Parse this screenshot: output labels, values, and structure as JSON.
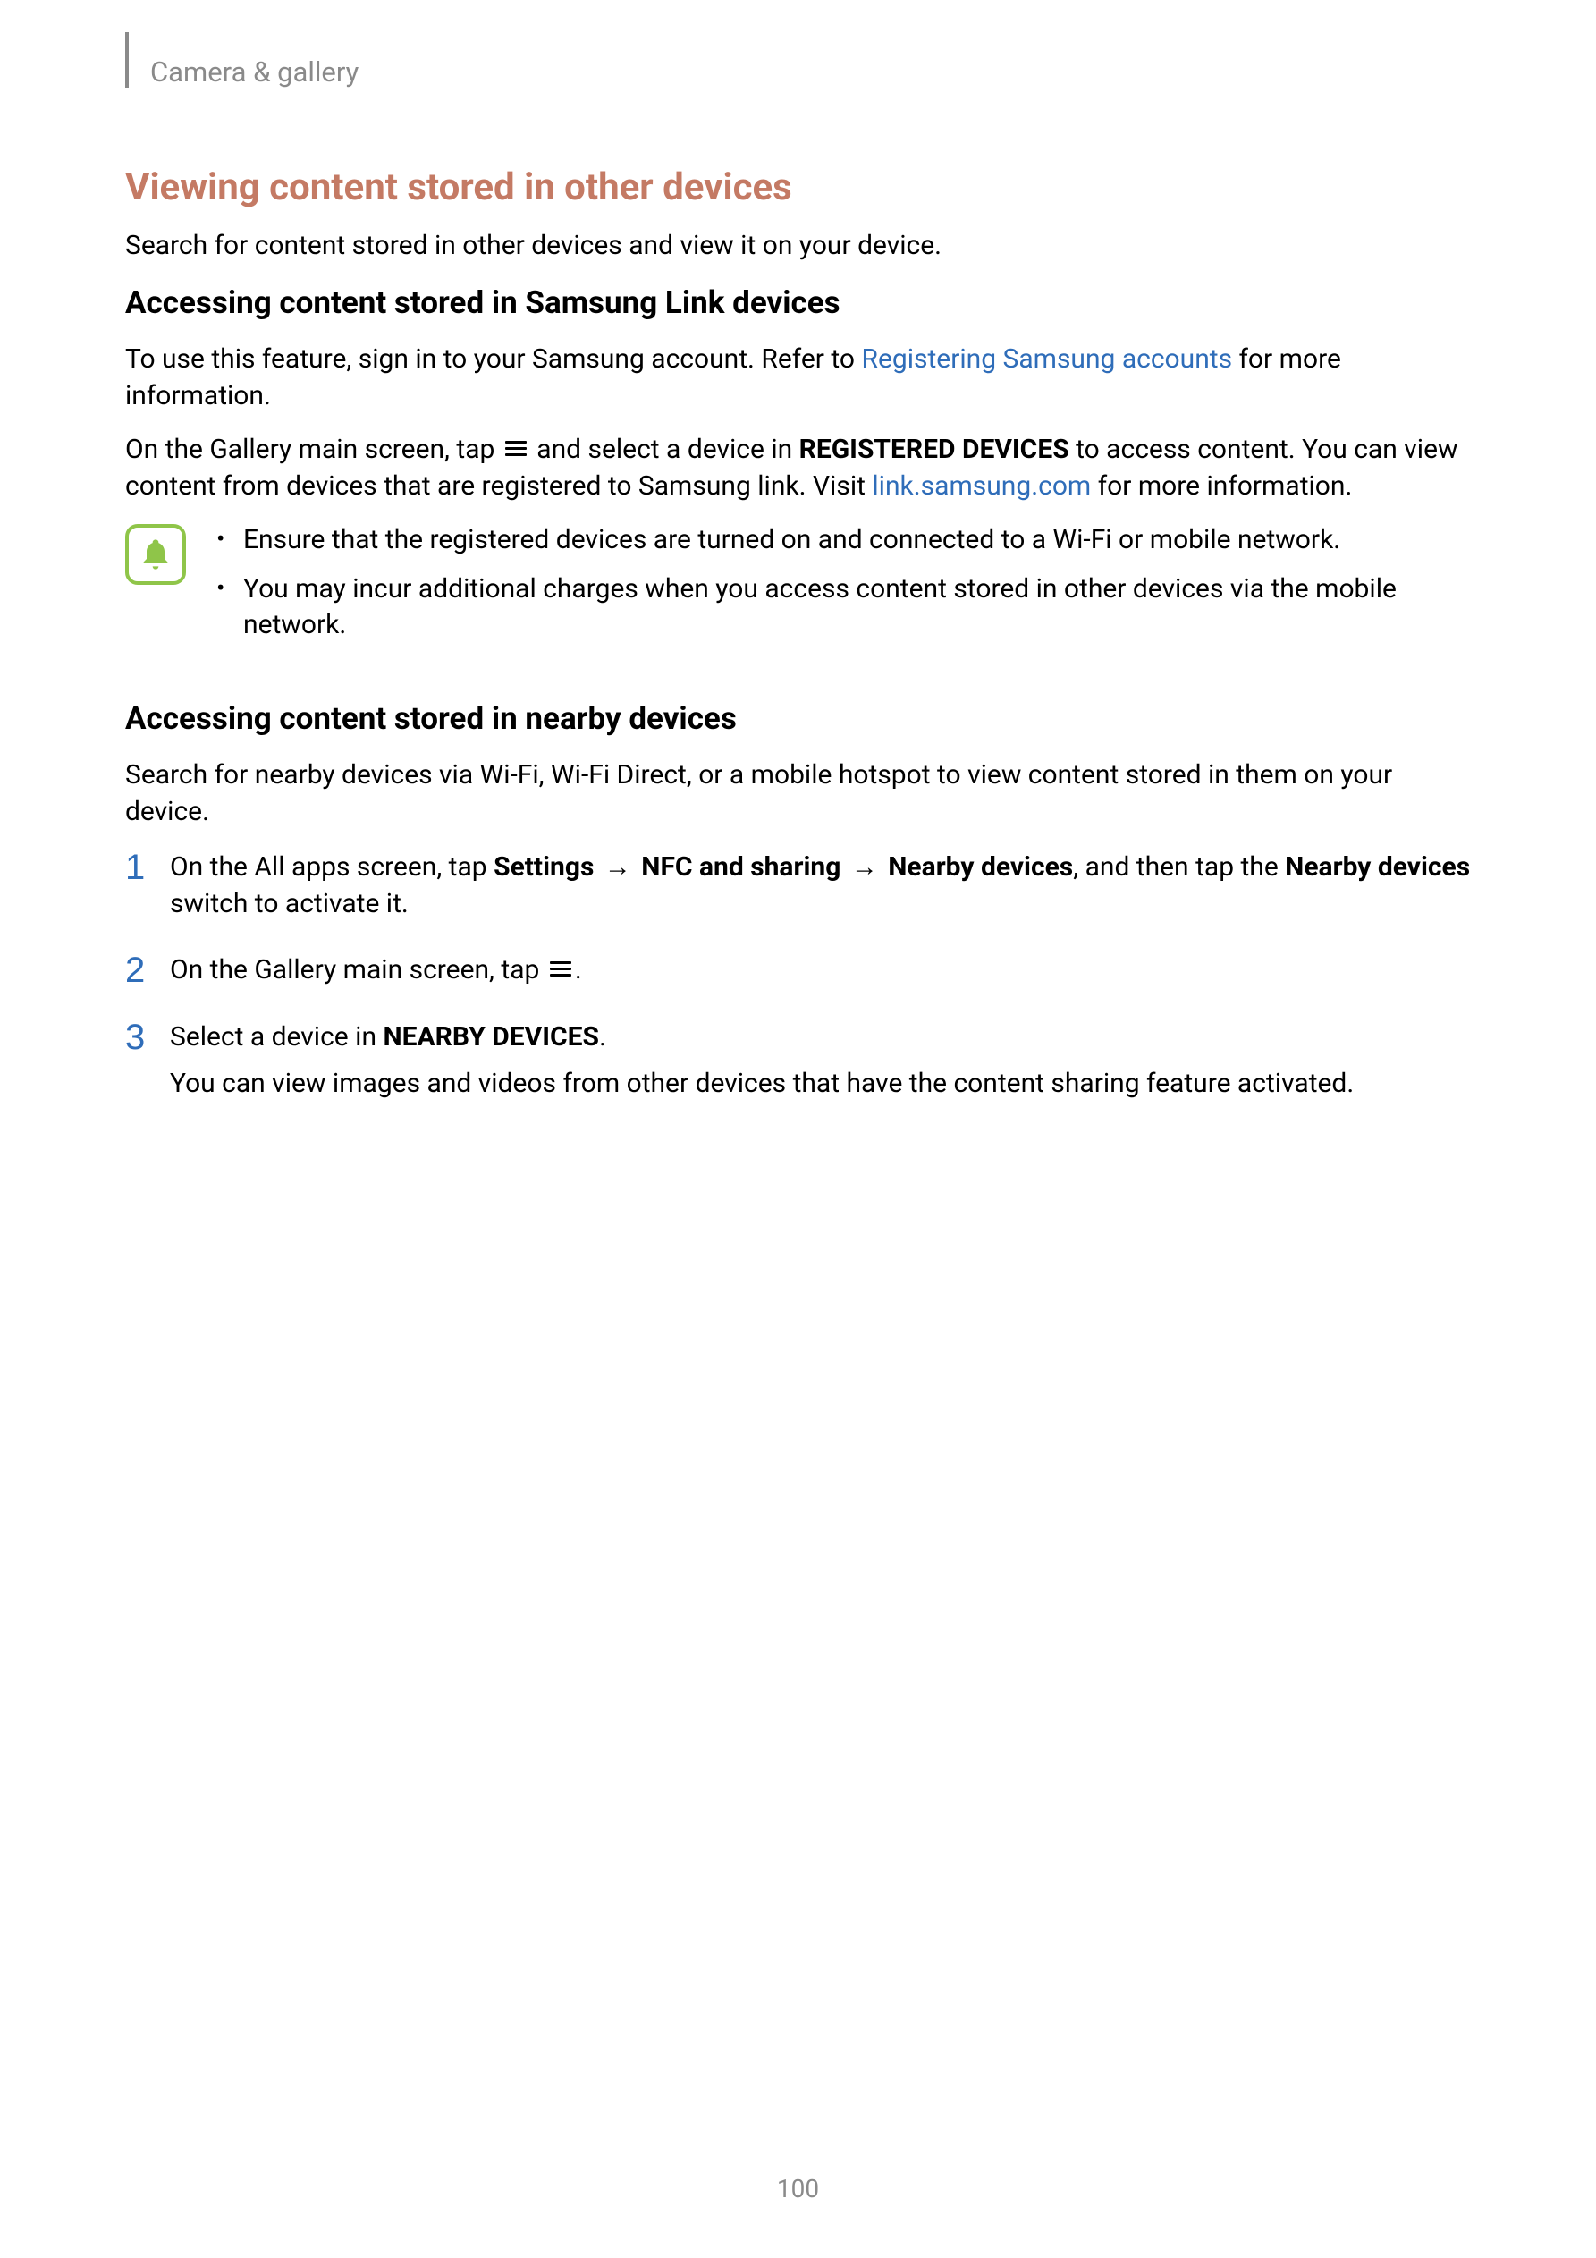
{
  "header": {
    "breadcrumb": "Camera & gallery"
  },
  "h2": "Viewing content stored in other devices",
  "intro": "Search for content stored in other devices and view it on your device.",
  "sec1": {
    "title": "Accessing content stored in Samsung Link devices",
    "p1_a": "To use this feature, sign in to your Samsung account. Refer to ",
    "p1_link": "Registering Samsung accounts",
    "p1_b": " for more information.",
    "p2_a": "On the Gallery main screen, tap ",
    "p2_b": " and select a device in ",
    "p2_bold": "REGISTERED DEVICES",
    "p2_c": " to access content. You can view content from devices that are registered to Samsung link. Visit ",
    "p2_link": "link.samsung.com",
    "p2_d": " for more information.",
    "note1": "Ensure that the registered devices are turned on and connected to a Wi-Fi or mobile network.",
    "note2": "You may incur additional charges when you access content stored in other devices via the mobile network."
  },
  "sec2": {
    "title": "Accessing content stored in nearby devices",
    "intro": "Search for nearby devices via Wi-Fi, Wi-Fi Direct, or a mobile hotspot to view content stored in them on your device.",
    "steps": {
      "n1": "1",
      "s1_a": "On the All apps screen, tap ",
      "s1_b1": "Settings",
      "s1_arrow": " → ",
      "s1_b2": "NFC and sharing",
      "s1_b3": "Nearby devices",
      "s1_c": ", and then tap the ",
      "s1_b4": "Nearby devices",
      "s1_d": " switch to activate it.",
      "n2": "2",
      "s2_a": "On the Gallery main screen, tap ",
      "s2_b": ".",
      "n3": "3",
      "s3_a": "Select a device in ",
      "s3_bold": "NEARBY DEVICES",
      "s3_b": ".",
      "s3_p2": "You can view images and videos from other devices that have the content sharing feature activated."
    }
  },
  "page": "100"
}
